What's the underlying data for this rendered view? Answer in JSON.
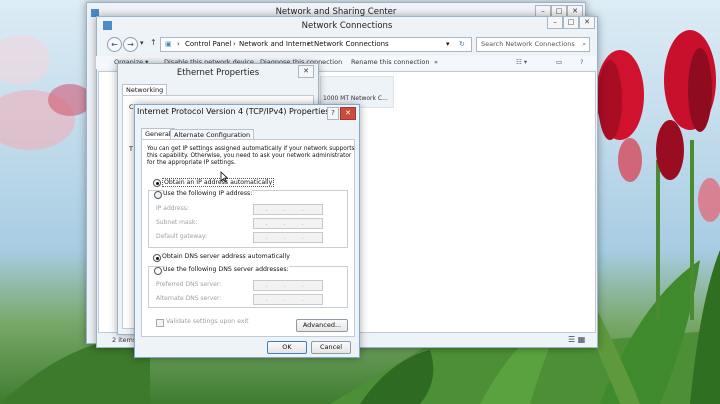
{
  "colors": {
    "accent": "#3f7fbf",
    "flower_red": "#c8102e",
    "stem_green": "#3a8a2a"
  },
  "nsc": {
    "title": "Network and Sharing Center"
  },
  "nc": {
    "title": "Network Connections",
    "breadcrumb": {
      "root": "Control Panel",
      "mid": "Network and Internet",
      "leaf": "Network Connections"
    },
    "search_placeholder": "Search Network Connections",
    "cmd": {
      "organize": "Organize ▾",
      "disable": "Disable this network device",
      "diagnose": "Diagnose this connection",
      "rename": "Rename this connection",
      "more": "»"
    },
    "adapter_label": "1000 MT Network C...",
    "status_items": "2 items"
  },
  "eth": {
    "title": "Ethernet Properties",
    "tab": "Networking",
    "partial_label": "Conn",
    "partial_label2": "T"
  },
  "ipv4": {
    "title": "Internet Protocol Version 4 (TCP/IPv4) Properties",
    "help": "?",
    "tabs": [
      "General",
      "Alternate Configuration"
    ],
    "desc1": "You can get IP settings assigned automatically if your network supports",
    "desc2": "this capability. Otherwise, you need to ask your network administrator",
    "desc3": "for the appropriate IP settings.",
    "opt_auto_ip": "Obtain an IP address automatically",
    "opt_manual_ip": "Use the following IP address:",
    "ip_address": "IP address:",
    "subnet_mask": "Subnet mask:",
    "default_gateway": "Default gateway:",
    "opt_auto_dns": "Obtain DNS server address automatically",
    "opt_manual_dns": "Use the following DNS server addresses:",
    "preferred_dns": "Preferred DNS server:",
    "alternate_dns": "Alternate DNS server:",
    "ip_dots": ". . .",
    "validate": "Validate settings upon exit",
    "advanced": "Advanced...",
    "ok": "OK",
    "cancel": "Cancel"
  }
}
